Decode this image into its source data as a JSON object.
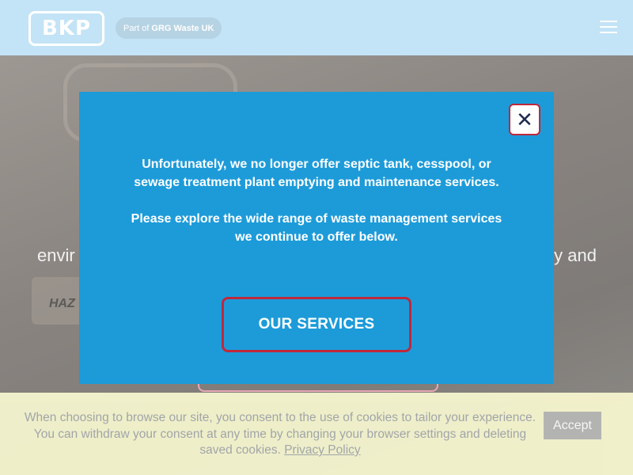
{
  "header": {
    "logo_text": "BKP",
    "parent_prefix": "Part of",
    "parent_name": "GRG Waste UK",
    "menu_icon": "hamburger-menu-icon"
  },
  "hero": {
    "text_left": "envir",
    "text_right": "y and",
    "tag_text": "HAZ"
  },
  "modal": {
    "message_1": "Unfortunately, we no longer offer septic tank, cesspool, or sewage treatment plant emptying and maintenance services.",
    "message_2": "Please explore the wide range of waste management services we continue to offer below.",
    "button_label": "OUR SERVICES",
    "close_symbol": "✕",
    "close_icon": "close-icon",
    "colors": {
      "background": "#1d9bd9",
      "accent": "#c0283c"
    }
  },
  "cookie": {
    "message": "When choosing to browse our site, you consent to the use of cookies to tailor your experience. You can withdraw your consent at any time by changing your browser settings and deleting saved cookies.",
    "policy_link": "Privacy Policy",
    "accept_label": "Accept"
  }
}
